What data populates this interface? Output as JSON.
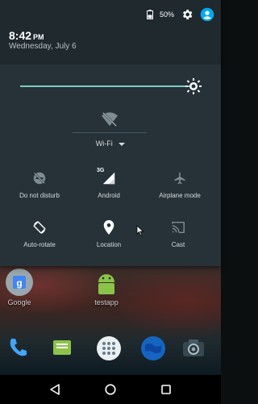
{
  "status": {
    "battery_percent": "50%"
  },
  "header": {
    "time": "8:42",
    "ampm": "PM",
    "date": "Wednesday, July 6"
  },
  "brightness": {
    "level": 0.93
  },
  "wifi": {
    "label": "Wi-Fi"
  },
  "tiles": [
    {
      "label": "Do not disturb",
      "icon": "do-not-disturb-icon"
    },
    {
      "label": "Android",
      "icon": "cellular-3g-icon",
      "badge": "3G"
    },
    {
      "label": "Airplane mode",
      "icon": "airplane-icon"
    },
    {
      "label": "Auto-rotate",
      "icon": "auto-rotate-icon"
    },
    {
      "label": "Location",
      "icon": "location-icon"
    },
    {
      "label": "Cast",
      "icon": "cast-icon"
    }
  ],
  "home": {
    "apps": [
      {
        "label": "Google"
      },
      {
        "label": "testapp"
      }
    ]
  },
  "colors": {
    "shade_bg": "#263238",
    "header_bg": "#1f292e",
    "accent": "#80cbc4",
    "profile_blue": "#03a9f4"
  }
}
